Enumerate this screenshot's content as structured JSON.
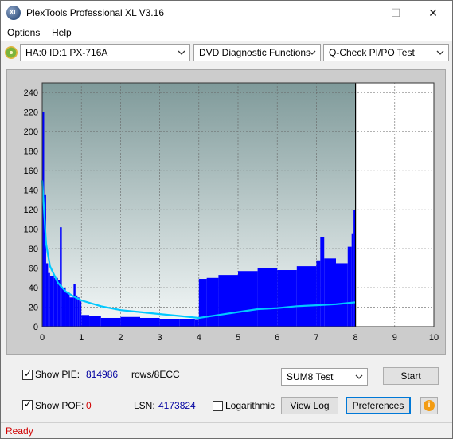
{
  "window": {
    "title": "PlexTools Professional XL V3.16",
    "icon_text": "XL",
    "controls": {
      "minimize": "—",
      "maximize": "☐",
      "close": "✕"
    }
  },
  "menu": [
    "Options",
    "Help"
  ],
  "toolbar": {
    "drive": "HA:0 ID:1  PX-716A",
    "function": "DVD Diagnostic Functions",
    "test": "Q-Check PI/PO Test"
  },
  "chart_data": {
    "type": "bar",
    "title": "",
    "xlabel": "",
    "ylabel": "",
    "xlim": [
      0,
      10
    ],
    "ylim": [
      0,
      250
    ],
    "x_ticks": [
      0,
      1,
      2,
      3,
      4,
      5,
      6,
      7,
      8,
      9,
      10
    ],
    "y_ticks": [
      0,
      20,
      40,
      60,
      80,
      100,
      120,
      140,
      160,
      180,
      200,
      220,
      240
    ],
    "grid": true,
    "data_end_x": 8.0,
    "colors": {
      "bars": "#0000ff",
      "speed_line": "#00c8ff",
      "plot_bg_top": "#7f9a9a",
      "plot_bg_bottom": "#f4f8f8",
      "frame": "#cccccc"
    },
    "series": [
      {
        "type": "bar",
        "x": [
          0.0,
          0.05,
          0.1,
          0.15,
          0.2,
          0.3,
          0.4,
          0.45,
          0.5,
          0.6,
          0.7,
          0.8,
          0.85,
          0.9,
          0.95,
          1.0,
          1.2,
          1.5,
          2.0,
          2.5,
          3.0,
          3.5,
          3.9,
          4.0,
          4.2,
          4.5,
          5.0,
          5.5,
          6.0,
          6.5,
          7.0,
          7.1,
          7.2,
          7.5,
          7.8,
          7.9,
          7.95,
          8.0
        ],
        "values": [
          220,
          135,
          65,
          55,
          52,
          50,
          48,
          102,
          40,
          35,
          30,
          44,
          32,
          30,
          26,
          12,
          11,
          9,
          10,
          9,
          8,
          8,
          7,
          49,
          50,
          53,
          57,
          60,
          58,
          62,
          68,
          92,
          70,
          65,
          82,
          95,
          120,
          0
        ]
      },
      {
        "type": "line",
        "x": [
          0.0,
          0.1,
          0.2,
          0.4,
          0.6,
          0.8,
          1.0,
          1.5,
          2.0,
          2.5,
          3.0,
          3.5,
          4.0,
          4.5,
          5.0,
          5.5,
          6.0,
          6.5,
          7.0,
          7.5,
          8.0
        ],
        "values": [
          150,
          85,
          62,
          45,
          36,
          31,
          27,
          21,
          17,
          15,
          13,
          11,
          9,
          12,
          15,
          18,
          19,
          21,
          22,
          23,
          25
        ]
      }
    ],
    "marker_line_x": 8.0
  },
  "controls": {
    "show_pie_label": "Show PIE:",
    "pie_value": "814986",
    "pie_unit": "rows/8ECC",
    "show_pof_label": "Show POF:",
    "pof_value": "0",
    "lsn_label": "LSN:",
    "lsn_value": "4173824",
    "logarithmic_label": "Logarithmic",
    "sum_test": "SUM8 Test",
    "start_button": "Start",
    "view_log_button": "View Log",
    "preferences_button": "Preferences",
    "info_button": "i"
  },
  "status": {
    "text": "Ready"
  }
}
